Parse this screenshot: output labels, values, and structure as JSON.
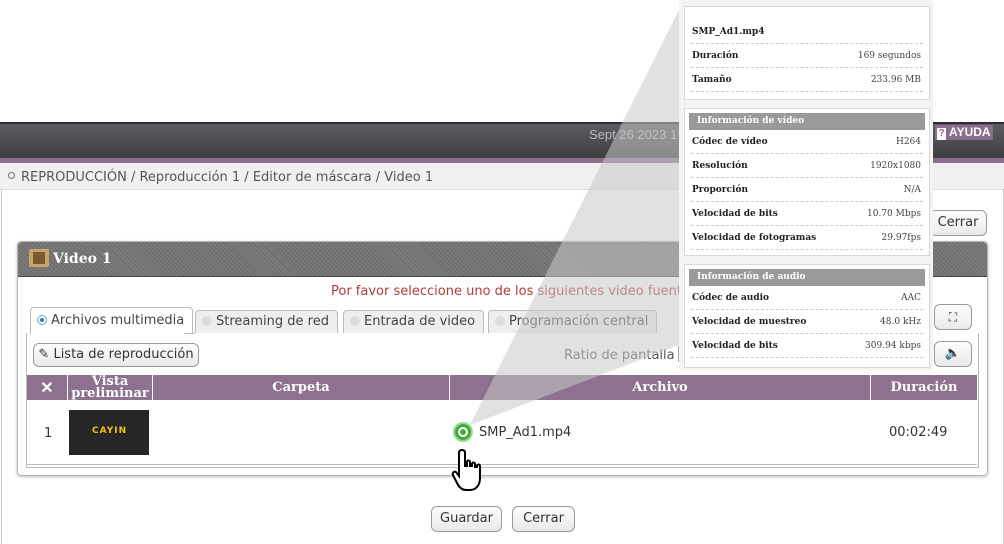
{
  "header": {
    "date_text": "Sept 26 2023 1",
    "help_icon": "?",
    "help_label": "AYUDA"
  },
  "breadcrumb": "REPRODUCCIÓN / Reproducción 1 / Editor de máscara / Video 1",
  "top_close_label": "Cerrar",
  "panel": {
    "title": "Video 1",
    "notice": "Por favor seleccione uno de los siguientes video fuentes."
  },
  "tabs": [
    {
      "label": "Archivos multimedia",
      "active": true
    },
    {
      "label": "Streaming de red",
      "active": false
    },
    {
      "label": "Entrada de video",
      "active": false
    },
    {
      "label": "Programación central",
      "active": false
    }
  ],
  "toolbar": {
    "playlist_label": "Lista de reproducción",
    "aspect_label": "Ratio de pantalla"
  },
  "table": {
    "headers": [
      "Vista preliminar",
      "Carpeta",
      "Archivo",
      "Duración"
    ],
    "rows": [
      {
        "index": "1",
        "thumb_text": "CAYIN",
        "folder": "",
        "file": "SMP_Ad1.mp4",
        "duration": "00:02:49"
      }
    ]
  },
  "footer": {
    "save_label": "Guardar",
    "cancel_label": "Cerrar"
  },
  "file_info": {
    "filename": "SMP_Ad1.mp4",
    "general": [
      {
        "key": "Duración",
        "value": "169 segundos"
      },
      {
        "key": "Tamaño",
        "value": "233.96 MB"
      }
    ],
    "video_header": "Información de vídeo",
    "video": [
      {
        "key": "Códec de vídeo",
        "value": "H264"
      },
      {
        "key": "Resolución",
        "value": "1920x1080"
      },
      {
        "key": "Proporción",
        "value": "N/A"
      },
      {
        "key": "Velocidad de bits",
        "value": "10.70 Mbps"
      },
      {
        "key": "Velocidad de fotogramas",
        "value": "29.97fps"
      }
    ],
    "audio_header": "Información de audio",
    "audio": [
      {
        "key": "Códec de audio",
        "value": "AAC"
      },
      {
        "key": "Velocidad de muestreo",
        "value": "48.0 kHz"
      },
      {
        "key": "Velocidad de bits",
        "value": "309.94 kbps"
      }
    ]
  },
  "colors": {
    "accent_purple": "#8d718f",
    "notice_red": "#b23a3a",
    "status_green": "#3fae3b"
  }
}
